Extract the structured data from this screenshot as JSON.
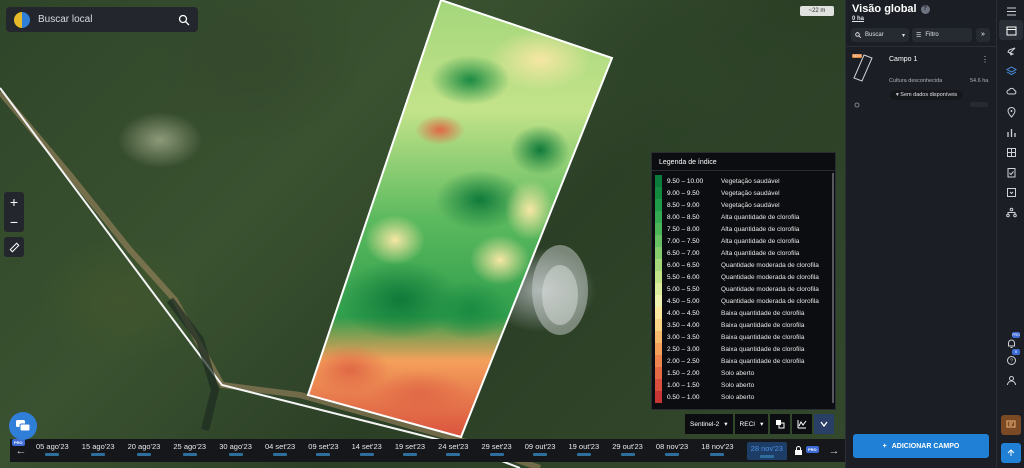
{
  "map": {
    "search_placeholder": "Buscar local",
    "scale_label": "~22 m",
    "zoom_in": "+",
    "zoom_out": "−"
  },
  "legend": {
    "title": "Legenda de índice",
    "rows": [
      {
        "range": "9.50 – 10.00",
        "label": "Vegetação saudável",
        "color": "#0b7a3b"
      },
      {
        "range": "9.00 – 9.50",
        "label": "Vegetação saudável",
        "color": "#13893f"
      },
      {
        "range": "8.50 – 9.00",
        "label": "Vegetação saudável",
        "color": "#1f9a48"
      },
      {
        "range": "8.00 – 8.50",
        "label": "Alta quantidade de clorofila",
        "color": "#35a852"
      },
      {
        "range": "7.50 – 8.00",
        "label": "Alta quantidade de clorofila",
        "color": "#4cb55a"
      },
      {
        "range": "7.00 – 7.50",
        "label": "Alta quantidade de clorofila",
        "color": "#68c064"
      },
      {
        "range": "6.50 – 7.00",
        "label": "Alta quantidade de clorofila",
        "color": "#86cc6e"
      },
      {
        "range": "6.00 – 6.50",
        "label": "Quantidade moderada de clorofila",
        "color": "#a6d77a"
      },
      {
        "range": "5.50 – 6.00",
        "label": "Quantidade moderada de clorofila",
        "color": "#c3e38a"
      },
      {
        "range": "5.00 – 5.50",
        "label": "Quantidade moderada de clorofila",
        "color": "#dcec9c"
      },
      {
        "range": "4.50 – 5.00",
        "label": "Quantidade moderada de clorofila",
        "color": "#f0f2b0"
      },
      {
        "range": "4.00 – 4.50",
        "label": "Baixa quantidade de clorofila",
        "color": "#fbe9a0"
      },
      {
        "range": "3.50 – 4.00",
        "label": "Baixa quantidade de clorofila",
        "color": "#fbd487"
      },
      {
        "range": "3.00 – 3.50",
        "label": "Baixa quantidade de clorofila",
        "color": "#f8bb6e"
      },
      {
        "range": "2.50 – 3.00",
        "label": "Baixa quantidade de clorofila",
        "color": "#f4a05b"
      },
      {
        "range": "2.00 – 2.50",
        "label": "Baixa quantidade de clorofila",
        "color": "#ee8550"
      },
      {
        "range": "1.50 – 2.00",
        "label": "Solo aberto",
        "color": "#e46a45"
      },
      {
        "range": "1.00 – 1.50",
        "label": "Solo aberto",
        "color": "#d94f3d"
      },
      {
        "range": "0.50 – 1.00",
        "label": "Solo aberto",
        "color": "#c93535"
      }
    ]
  },
  "satellite": {
    "source": "Sentinel-2",
    "index": "RECI"
  },
  "timeline": {
    "pro_badge": "PRO",
    "dates": [
      "05 ago'23",
      "15 ago'23",
      "20 ago'23",
      "25 ago'23",
      "30 ago'23",
      "04 set'23",
      "09 set'23",
      "14 set'23",
      "19 set'23",
      "24 set'23",
      "29 set'23",
      "09 out'23",
      "19 out'23",
      "29 out'23",
      "08 nov'23",
      "18 nov'23",
      "28 nov'23"
    ],
    "active_date": "28 nov'23"
  },
  "panel": {
    "title": "Visão global",
    "subtitle": "0 ha",
    "search_label": "Buscar",
    "filter_label": "Filtro",
    "field": {
      "badge": "NDVI",
      "name": "Campo 1",
      "crop": "Cultura desconhecida",
      "area": "54.6 ha",
      "status": "Sem dados disponíveis"
    },
    "add_button": "ADICIONAR CAMPO"
  },
  "rail": {
    "badge_1": "PRO",
    "badge_2": "5"
  },
  "colors": {
    "accent": "#1f80d6",
    "panel_bg": "#1b1e24",
    "active_date": "#4a90e2"
  }
}
